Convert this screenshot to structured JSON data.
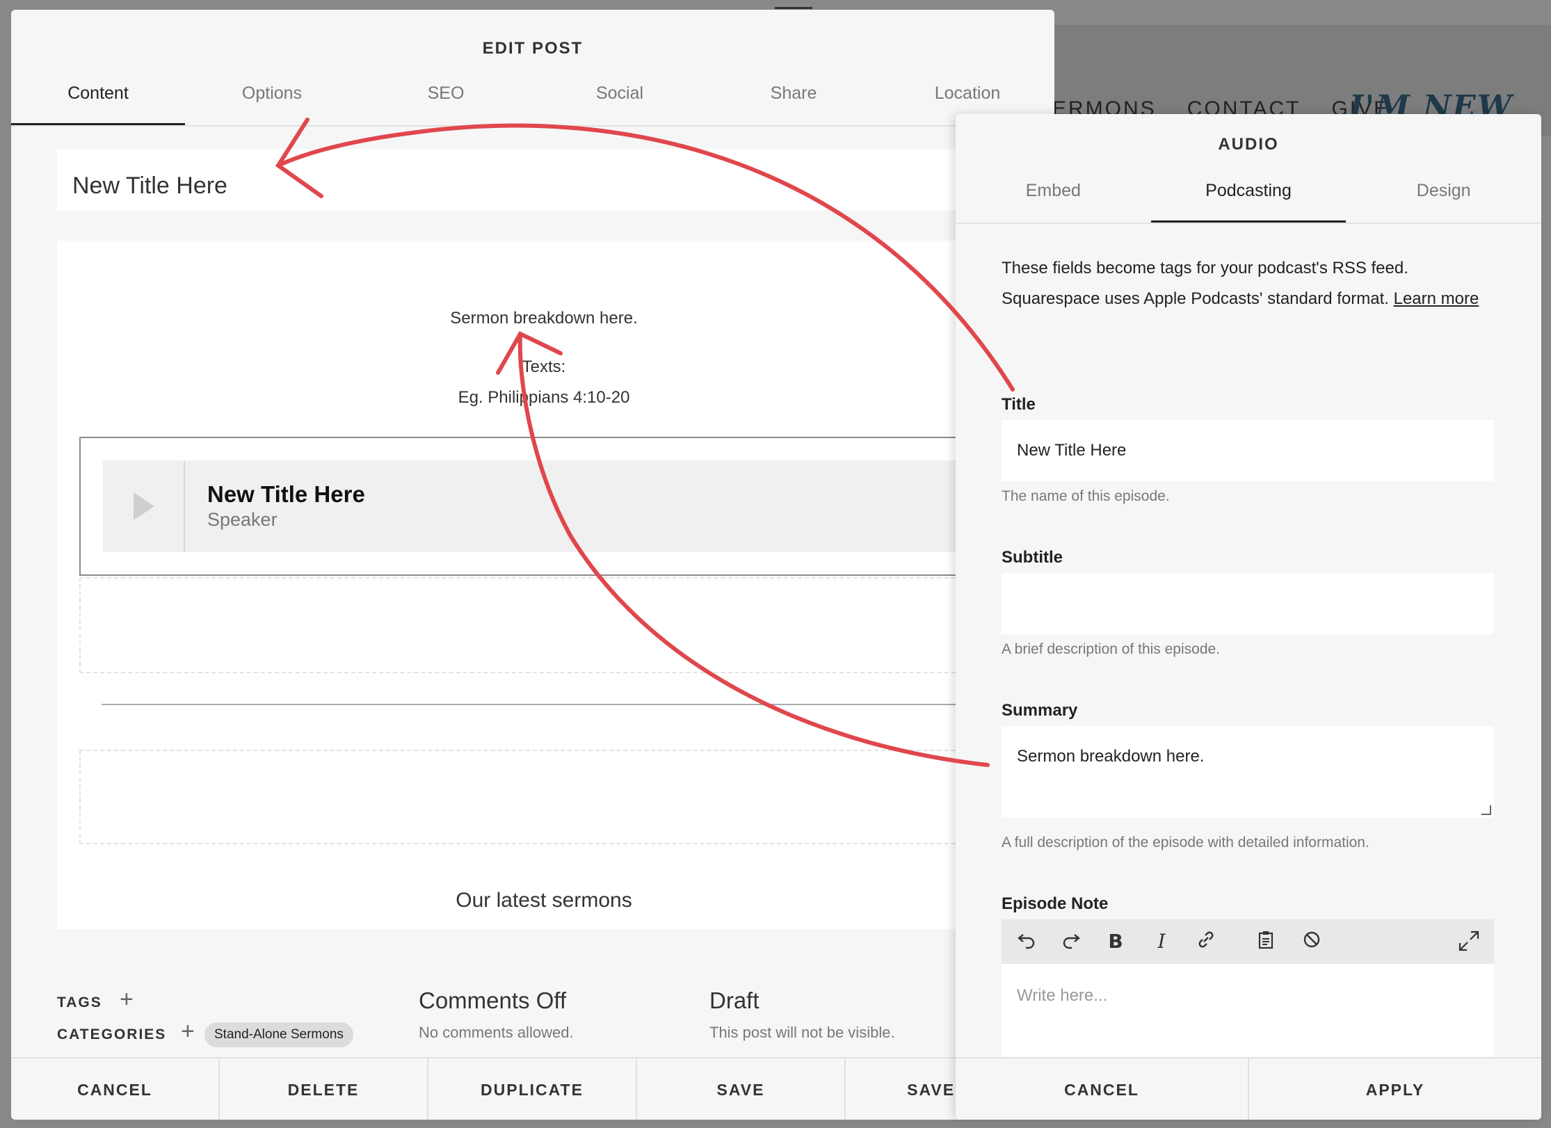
{
  "background_site": {
    "nav": [
      "SERMONS",
      "CONTACT",
      "GIVE"
    ],
    "brand": "I'M NEW"
  },
  "edit_post": {
    "title": "EDIT POST",
    "tabs": [
      "Content",
      "Options",
      "SEO",
      "Social",
      "Share",
      "Location"
    ],
    "post_title": "New Title Here",
    "body": {
      "line1": "Sermon breakdown here.",
      "texts_label": "Texts:",
      "texts_value": "Eg. Philippians 4:10-20"
    },
    "audio_block": {
      "title": "New Title Here",
      "speaker": "Speaker"
    },
    "latest_heading": "Our latest sermons",
    "meta": {
      "tags_label": "TAGS",
      "categories_label": "CATEGORIES",
      "category_chip": "Stand-Alone Sermons",
      "comments_title": "Comments Off",
      "comments_sub": "No comments allowed.",
      "status_title": "Draft",
      "status_sub": "This post will not be visible."
    },
    "footer": [
      "CANCEL",
      "DELETE",
      "DUPLICATE",
      "SAVE",
      "SAVE & P"
    ]
  },
  "audio_panel": {
    "title": "AUDIO",
    "tabs": [
      "Embed",
      "Podcasting",
      "Design"
    ],
    "intro": "These fields become tags for your podcast's RSS feed. Squarespace uses Apple Podcasts' standard format.",
    "learn_more": "Learn more",
    "fields": {
      "title": {
        "label": "Title",
        "value": "New Title Here",
        "help": "The name of this episode."
      },
      "subtitle": {
        "label": "Subtitle",
        "value": "",
        "help": "A brief description of this episode."
      },
      "summary": {
        "label": "Summary",
        "value": "Sermon breakdown here.",
        "help": "A full description of the episode with detailed information."
      },
      "episode_note": {
        "label": "Episode Note",
        "placeholder": "Write here..."
      }
    },
    "toolbar_icons": [
      "undo-icon",
      "redo-icon",
      "bold-icon",
      "italic-icon",
      "link-icon",
      "clipboard-icon",
      "clear-format-icon",
      "expand-icon"
    ],
    "footer": [
      "CANCEL",
      "APPLY"
    ]
  },
  "colors": {
    "annotation_arrow": "#e0474c",
    "panel_bg": "#f6f6f6"
  }
}
